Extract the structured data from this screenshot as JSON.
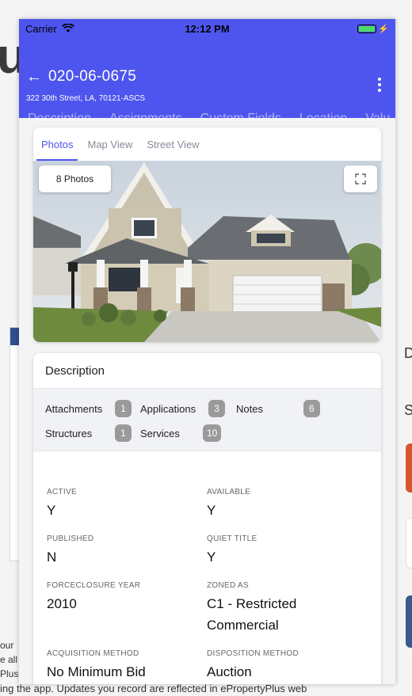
{
  "background": {
    "heading_fragment": "u",
    "side_letter_d": "D",
    "side_letter_s": "S",
    "text_lines": [
      "our",
      "e all",
      "Plus"
    ],
    "bottom_text": "ing the app. Updates you record are reflected in ePropertyPlus web"
  },
  "status_bar": {
    "carrier": "Carrier",
    "time": "12:12 PM"
  },
  "header": {
    "title": "020-06-0675",
    "address": "322 30th Street, LA, 70121-ASCS",
    "tabs": [
      "Description",
      "Assignments",
      "Custom Fields",
      "Location",
      "Valu"
    ]
  },
  "media": {
    "tabs": [
      "Photos",
      "Map View",
      "Street View"
    ],
    "active_tab": "Photos",
    "photo_count_label": "8 Photos"
  },
  "description": {
    "title": "Description",
    "chips": [
      {
        "label": "Attachments",
        "count": "1"
      },
      {
        "label": "Applications",
        "count": "3"
      },
      {
        "label": "Notes",
        "count": "6"
      },
      {
        "label": "Structures",
        "count": "1"
      },
      {
        "label": "Services",
        "count": "10"
      }
    ],
    "fields": [
      {
        "label": "ACTIVE",
        "value": "Y"
      },
      {
        "label": "AVAILABLE",
        "value": "Y"
      },
      {
        "label": "PUBLISHED",
        "value": "N"
      },
      {
        "label": "QUIET TITLE",
        "value": "Y"
      },
      {
        "label": "FORCECLOSURE YEAR",
        "value": "2010"
      },
      {
        "label": "ZONED AS",
        "value": "C1 - Restricted Commercial"
      },
      {
        "label": "ACQUISITION METHOD",
        "value": "No Minimum Bid"
      },
      {
        "label": "DISPOSITION METHOD",
        "value": "Auction"
      }
    ]
  },
  "colors": {
    "accent": "#4e55ee",
    "badge": "#9a9a9a"
  }
}
